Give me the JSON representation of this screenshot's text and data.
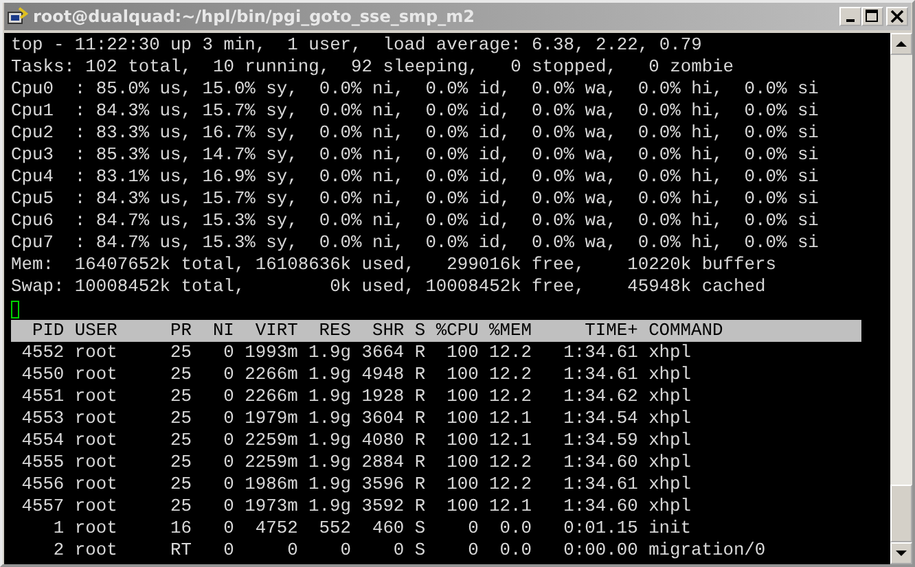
{
  "window": {
    "title": "root@dualquad:~/hpl/bin/pgi_goto_sse_smp_m2"
  },
  "summary": [
    "top - 11:22:30 up 3 min,  1 user,  load average: 6.38, 2.22, 0.79",
    "Tasks: 102 total,  10 running,  92 sleeping,   0 stopped,   0 zombie",
    "Cpu0  : 85.0% us, 15.0% sy,  0.0% ni,  0.0% id,  0.0% wa,  0.0% hi,  0.0% si",
    "Cpu1  : 84.3% us, 15.7% sy,  0.0% ni,  0.0% id,  0.0% wa,  0.0% hi,  0.0% si",
    "Cpu2  : 83.3% us, 16.7% sy,  0.0% ni,  0.0% id,  0.0% wa,  0.0% hi,  0.0% si",
    "Cpu3  : 85.3% us, 14.7% sy,  0.0% ni,  0.0% id,  0.0% wa,  0.0% hi,  0.0% si",
    "Cpu4  : 83.1% us, 16.9% sy,  0.0% ni,  0.0% id,  0.0% wa,  0.0% hi,  0.0% si",
    "Cpu5  : 84.3% us, 15.7% sy,  0.0% ni,  0.0% id,  0.0% wa,  0.0% hi,  0.0% si",
    "Cpu6  : 84.7% us, 15.3% sy,  0.0% ni,  0.0% id,  0.0% wa,  0.0% hi,  0.0% si",
    "Cpu7  : 84.7% us, 15.3% sy,  0.0% ni,  0.0% id,  0.0% wa,  0.0% hi,  0.0% si",
    "Mem:  16407652k total, 16108636k used,   299016k free,    10220k buffers",
    "Swap: 10008452k total,        0k used, 10008452k free,    45948k cached"
  ],
  "table": {
    "columns": [
      "PID",
      "USER",
      "PR",
      "NI",
      "VIRT",
      "RES",
      "SHR",
      "S",
      "%CPU",
      "%MEM",
      "TIME+",
      "COMMAND"
    ],
    "rows": [
      [
        "4552",
        "root",
        "25",
        "0",
        "1993m",
        "1.9g",
        "3664",
        "R",
        "100",
        "12.2",
        "1:34.61",
        "xhpl"
      ],
      [
        "4550",
        "root",
        "25",
        "0",
        "2266m",
        "1.9g",
        "4948",
        "R",
        "100",
        "12.2",
        "1:34.61",
        "xhpl"
      ],
      [
        "4551",
        "root",
        "25",
        "0",
        "2266m",
        "1.9g",
        "1928",
        "R",
        "100",
        "12.2",
        "1:34.62",
        "xhpl"
      ],
      [
        "4553",
        "root",
        "25",
        "0",
        "1979m",
        "1.9g",
        "3604",
        "R",
        "100",
        "12.1",
        "1:34.54",
        "xhpl"
      ],
      [
        "4554",
        "root",
        "25",
        "0",
        "2259m",
        "1.9g",
        "4080",
        "R",
        "100",
        "12.1",
        "1:34.59",
        "xhpl"
      ],
      [
        "4555",
        "root",
        "25",
        "0",
        "2259m",
        "1.9g",
        "2884",
        "R",
        "100",
        "12.2",
        "1:34.60",
        "xhpl"
      ],
      [
        "4556",
        "root",
        "25",
        "0",
        "1986m",
        "1.9g",
        "3596",
        "R",
        "100",
        "12.2",
        "1:34.61",
        "xhpl"
      ],
      [
        "4557",
        "root",
        "25",
        "0",
        "1973m",
        "1.9g",
        "3592",
        "R",
        "100",
        "12.1",
        "1:34.60",
        "xhpl"
      ],
      [
        "1",
        "root",
        "16",
        "0",
        "4752",
        "552",
        "460",
        "S",
        "0",
        "0.0",
        "0:01.15",
        "init"
      ],
      [
        "2",
        "root",
        "RT",
        "0",
        "0",
        "0",
        "0",
        "S",
        "0",
        "0.0",
        "0:00.00",
        "migration/0"
      ]
    ]
  }
}
